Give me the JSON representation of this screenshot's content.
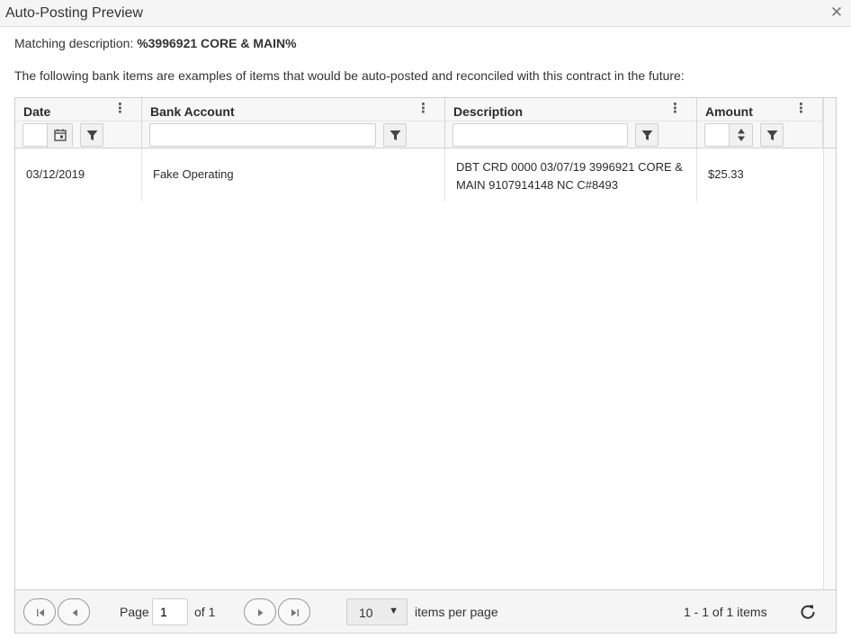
{
  "window": {
    "title": "Auto-Posting Preview"
  },
  "matching": {
    "label": "Matching description: ",
    "value": "%3996921 CORE & MAIN%"
  },
  "explain": "The following bank items are examples of items that would be auto-posted and reconciled with this contract in the future:",
  "columns": [
    {
      "label": "Date"
    },
    {
      "label": "Bank Account"
    },
    {
      "label": "Description"
    },
    {
      "label": "Amount"
    }
  ],
  "filters": {
    "date": "",
    "bank_account": "",
    "description": "",
    "amount": ""
  },
  "rows": [
    {
      "date": "03/12/2019",
      "bank_account": "Fake Operating",
      "description": "DBT CRD 0000 03/07/19 3996921 CORE & MAIN 9107914148 NC C#8493",
      "amount": "$25.33"
    }
  ],
  "pager": {
    "page_label": "Page",
    "page_value": "1",
    "of_label": "of 1",
    "page_size": "10",
    "items_per_page_label": "items per page",
    "range_label": "1 - 1 of 1 items"
  }
}
